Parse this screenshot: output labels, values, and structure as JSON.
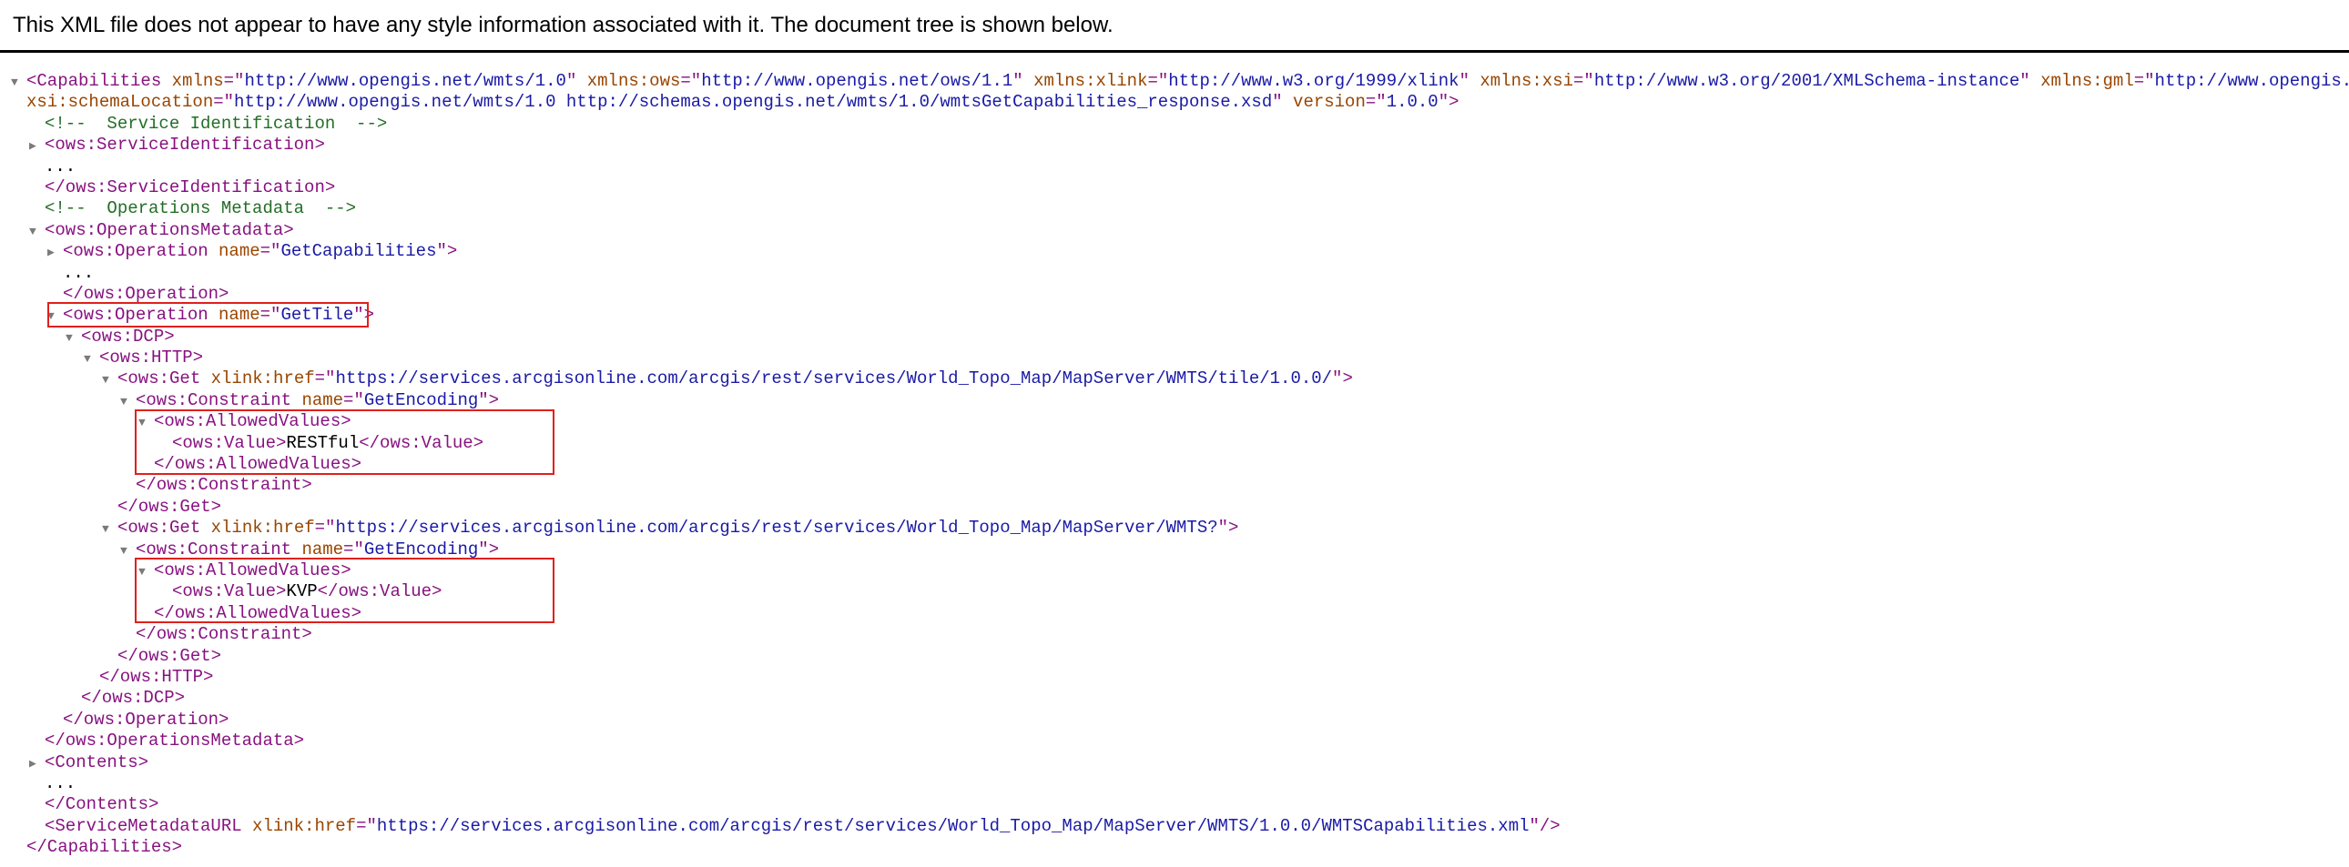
{
  "info_message": "This XML file does not appear to have any style information associated with it. The document tree is shown below.",
  "colors": {
    "tag": "#881280",
    "attr_name": "#994500",
    "attr_value": "#1a1aa6",
    "comment": "#236e25",
    "highlight": "#e0201c"
  },
  "tree": [
    {
      "indent": 0,
      "arrow": "down",
      "parts": [
        [
          "tag",
          "<Capabilities "
        ],
        [
          "an",
          "xmlns"
        ],
        [
          "tag",
          "=\""
        ],
        [
          "av",
          "http://www.opengis.net/wmts/1.0"
        ],
        [
          "tag",
          "\" "
        ],
        [
          "an",
          "xmlns:ows"
        ],
        [
          "tag",
          "=\""
        ],
        [
          "av",
          "http://www.opengis.net/ows/1.1"
        ],
        [
          "tag",
          "\" "
        ],
        [
          "an",
          "xmlns:xlink"
        ],
        [
          "tag",
          "=\""
        ],
        [
          "av",
          "http://www.w3.org/1999/xlink"
        ],
        [
          "tag",
          "\" "
        ],
        [
          "an",
          "xmlns:xsi"
        ],
        [
          "tag",
          "=\""
        ],
        [
          "av",
          "http://www.w3.org/2001/XMLSchema-instance"
        ],
        [
          "tag",
          "\" "
        ],
        [
          "an",
          "xmlns:gml"
        ],
        [
          "tag",
          "=\""
        ],
        [
          "av",
          "http://www.opengis.net/gml"
        ],
        [
          "tag",
          "\""
        ]
      ]
    },
    {
      "indent": 0,
      "arrow": "none",
      "parts": [
        [
          "an",
          "xsi:schemaLocation"
        ],
        [
          "tag",
          "=\""
        ],
        [
          "av",
          "http://www.opengis.net/wmts/1.0 http://schemas.opengis.net/wmts/1.0/wmtsGetCapabilities_response.xsd"
        ],
        [
          "tag",
          "\" "
        ],
        [
          "an",
          "version"
        ],
        [
          "tag",
          "=\""
        ],
        [
          "av",
          "1.0.0"
        ],
        [
          "tag",
          "\">"
        ]
      ]
    },
    {
      "indent": 1,
      "arrow": "none",
      "parts": [
        [
          "cm",
          "<!--  Service Identification  -->"
        ]
      ]
    },
    {
      "indent": 1,
      "arrow": "right",
      "parts": [
        [
          "tag",
          "<ows:ServiceIdentification>"
        ]
      ]
    },
    {
      "indent": 1,
      "arrow": "none",
      "parts": [
        [
          "tx",
          "..."
        ]
      ]
    },
    {
      "indent": 1,
      "arrow": "none",
      "parts": [
        [
          "tag",
          "</ows:ServiceIdentification>"
        ]
      ]
    },
    {
      "indent": 1,
      "arrow": "none",
      "parts": [
        [
          "cm",
          "<!--  Operations Metadata  -->"
        ]
      ]
    },
    {
      "indent": 1,
      "arrow": "down",
      "parts": [
        [
          "tag",
          "<ows:OperationsMetadata>"
        ]
      ]
    },
    {
      "indent": 2,
      "arrow": "right",
      "parts": [
        [
          "tag",
          "<ows:Operation "
        ],
        [
          "an",
          "name"
        ],
        [
          "tag",
          "=\""
        ],
        [
          "av",
          "GetCapabilities"
        ],
        [
          "tag",
          "\">"
        ]
      ]
    },
    {
      "indent": 2,
      "arrow": "none",
      "parts": [
        [
          "tx",
          "..."
        ]
      ]
    },
    {
      "indent": 2,
      "arrow": "none",
      "parts": [
        [
          "tag",
          "</ows:Operation>"
        ]
      ]
    },
    {
      "indent": 2,
      "arrow": "down",
      "parts": [
        [
          "tag",
          "<ows:Operation "
        ],
        [
          "an",
          "name"
        ],
        [
          "tag",
          "=\""
        ],
        [
          "av",
          "GetTile"
        ],
        [
          "tag",
          "\">"
        ]
      ]
    },
    {
      "indent": 3,
      "arrow": "down",
      "parts": [
        [
          "tag",
          "<ows:DCP>"
        ]
      ]
    },
    {
      "indent": 4,
      "arrow": "down",
      "parts": [
        [
          "tag",
          "<ows:HTTP>"
        ]
      ]
    },
    {
      "indent": 5,
      "arrow": "down",
      "parts": [
        [
          "tag",
          "<ows:Get "
        ],
        [
          "an",
          "xlink:href"
        ],
        [
          "tag",
          "=\""
        ],
        [
          "av",
          "https://services.arcgisonline.com/arcgis/rest/services/World_Topo_Map/MapServer/WMTS/tile/1.0.0/"
        ],
        [
          "tag",
          "\">"
        ]
      ]
    },
    {
      "indent": 6,
      "arrow": "down",
      "parts": [
        [
          "tag",
          "<ows:Constraint "
        ],
        [
          "an",
          "name"
        ],
        [
          "tag",
          "=\""
        ],
        [
          "av",
          "GetEncoding"
        ],
        [
          "tag",
          "\">"
        ]
      ]
    },
    {
      "indent": 7,
      "arrow": "down",
      "parts": [
        [
          "tag",
          "<ows:AllowedValues>"
        ]
      ]
    },
    {
      "indent": 8,
      "arrow": "none",
      "parts": [
        [
          "tag",
          "<ows:Value>"
        ],
        [
          "tx",
          "RESTful"
        ],
        [
          "tag",
          "</ows:Value>"
        ]
      ]
    },
    {
      "indent": 7,
      "arrow": "none",
      "parts": [
        [
          "tag",
          "</ows:AllowedValues>"
        ]
      ]
    },
    {
      "indent": 6,
      "arrow": "none",
      "parts": [
        [
          "tag",
          "</ows:Constraint>"
        ]
      ]
    },
    {
      "indent": 5,
      "arrow": "none",
      "parts": [
        [
          "tag",
          "</ows:Get>"
        ]
      ]
    },
    {
      "indent": 5,
      "arrow": "down",
      "parts": [
        [
          "tag",
          "<ows:Get "
        ],
        [
          "an",
          "xlink:href"
        ],
        [
          "tag",
          "=\""
        ],
        [
          "av",
          "https://services.arcgisonline.com/arcgis/rest/services/World_Topo_Map/MapServer/WMTS?"
        ],
        [
          "tag",
          "\">"
        ]
      ]
    },
    {
      "indent": 6,
      "arrow": "down",
      "parts": [
        [
          "tag",
          "<ows:Constraint "
        ],
        [
          "an",
          "name"
        ],
        [
          "tag",
          "=\""
        ],
        [
          "av",
          "GetEncoding"
        ],
        [
          "tag",
          "\">"
        ]
      ]
    },
    {
      "indent": 7,
      "arrow": "down",
      "parts": [
        [
          "tag",
          "<ows:AllowedValues>"
        ]
      ]
    },
    {
      "indent": 8,
      "arrow": "none",
      "parts": [
        [
          "tag",
          "<ows:Value>"
        ],
        [
          "tx",
          "KVP"
        ],
        [
          "tag",
          "</ows:Value>"
        ]
      ]
    },
    {
      "indent": 7,
      "arrow": "none",
      "parts": [
        [
          "tag",
          "</ows:AllowedValues>"
        ]
      ]
    },
    {
      "indent": 6,
      "arrow": "none",
      "parts": [
        [
          "tag",
          "</ows:Constraint>"
        ]
      ]
    },
    {
      "indent": 5,
      "arrow": "none",
      "parts": [
        [
          "tag",
          "</ows:Get>"
        ]
      ]
    },
    {
      "indent": 4,
      "arrow": "none",
      "parts": [
        [
          "tag",
          "</ows:HTTP>"
        ]
      ]
    },
    {
      "indent": 3,
      "arrow": "none",
      "parts": [
        [
          "tag",
          "</ows:DCP>"
        ]
      ]
    },
    {
      "indent": 2,
      "arrow": "none",
      "parts": [
        [
          "tag",
          "</ows:Operation>"
        ]
      ]
    },
    {
      "indent": 1,
      "arrow": "none",
      "parts": [
        [
          "tag",
          "</ows:OperationsMetadata>"
        ]
      ]
    },
    {
      "indent": 1,
      "arrow": "right",
      "parts": [
        [
          "tag",
          "<Contents>"
        ]
      ]
    },
    {
      "indent": 1,
      "arrow": "none",
      "parts": [
        [
          "tx",
          "..."
        ]
      ]
    },
    {
      "indent": 1,
      "arrow": "none",
      "parts": [
        [
          "tag",
          "</Contents>"
        ]
      ]
    },
    {
      "indent": 1,
      "arrow": "none",
      "parts": [
        [
          "tag",
          "<ServiceMetadataURL "
        ],
        [
          "an",
          "xlink:href"
        ],
        [
          "tag",
          "=\""
        ],
        [
          "av",
          "https://services.arcgisonline.com/arcgis/rest/services/World_Topo_Map/MapServer/WMTS/1.0.0/WMTSCapabilities.xml"
        ],
        [
          "tag",
          "\"/>"
        ]
      ]
    },
    {
      "indent": 0,
      "arrow": "none",
      "parts": [
        [
          "tag",
          "</Capabilities>"
        ]
      ]
    }
  ]
}
